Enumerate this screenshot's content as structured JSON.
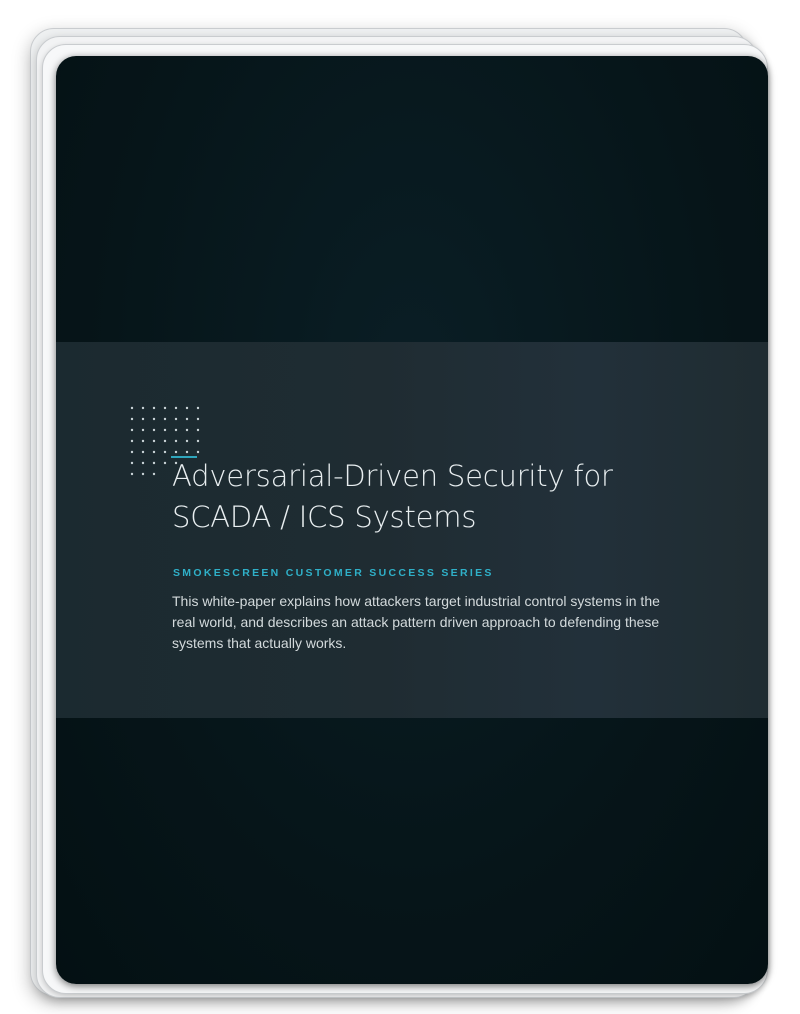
{
  "document": {
    "title_lines": [
      "Adversarial-Driven Security for",
      "SCADA / ICS Systems"
    ],
    "series_label": "SMOKESCREEN CUSTOMER SUCCESS SERIES",
    "description_lines": [
      "This white-paper explains how attackers target industrial control systems in the",
      "real world, and describes an attack pattern driven approach to defending these",
      "systems that actually works."
    ]
  },
  "colors": {
    "cover_background": "#061519",
    "band_background": "#1f2c32",
    "accent": "#2fb0c8",
    "title_text": "#e8eef0",
    "body_text": "#d3dadc"
  },
  "icons": {
    "decoration": "dot-grid-icon"
  }
}
